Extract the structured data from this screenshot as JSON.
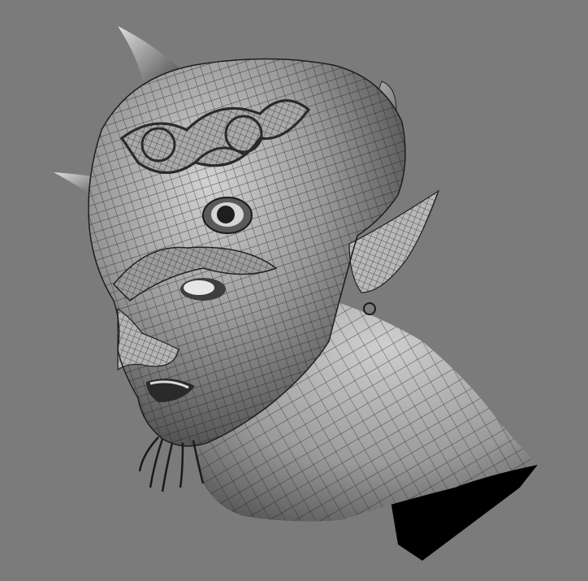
{
  "viewport": {
    "background_color": "#7b7b7b",
    "model_colors": {
      "skin_light": "#c9c9c9",
      "skin_mid": "#8e8e8e",
      "skin_dark": "#3a3a3a",
      "wire": "#1a1a1a",
      "shadow": "#000000"
    },
    "subject": "wireframe-demon-head-sculpt"
  }
}
